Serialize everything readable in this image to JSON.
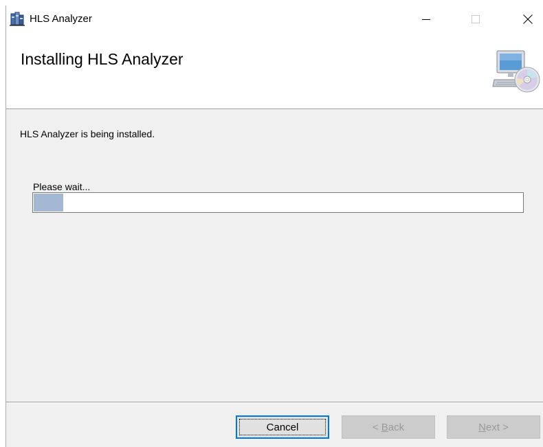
{
  "window": {
    "title": "HLS Analyzer",
    "controls": {
      "minimize_icon": "minimize-icon",
      "maximize_icon": "maximize-icon",
      "close_icon": "close-icon"
    }
  },
  "header": {
    "title": "Installing HLS Analyzer",
    "graphic_icon": "computer-with-disc-icon"
  },
  "body": {
    "status": "HLS Analyzer is being installed.",
    "wait_label": "Please wait...",
    "progress_percent": 6
  },
  "footer": {
    "cancel_label": "Cancel",
    "back_prefix": "< ",
    "back_accel": "B",
    "back_rest": "ack",
    "next_accel": "N",
    "next_rest": "ext >"
  },
  "colors": {
    "window_bg": "#f0f0f0",
    "progress_fill": "#a4b8d4",
    "focus_border": "#0078d7"
  }
}
